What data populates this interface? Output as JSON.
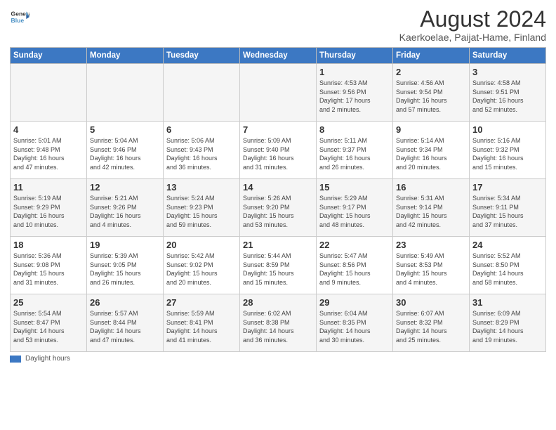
{
  "header": {
    "logo_line1": "General",
    "logo_line2": "Blue",
    "title": "August 2024",
    "subtitle": "Kaerkoelae, Paijat-Hame, Finland"
  },
  "days_of_week": [
    "Sunday",
    "Monday",
    "Tuesday",
    "Wednesday",
    "Thursday",
    "Friday",
    "Saturday"
  ],
  "weeks": [
    [
      {
        "num": "",
        "info": ""
      },
      {
        "num": "",
        "info": ""
      },
      {
        "num": "",
        "info": ""
      },
      {
        "num": "",
        "info": ""
      },
      {
        "num": "1",
        "info": "Sunrise: 4:53 AM\nSunset: 9:56 PM\nDaylight: 17 hours\nand 2 minutes."
      },
      {
        "num": "2",
        "info": "Sunrise: 4:56 AM\nSunset: 9:54 PM\nDaylight: 16 hours\nand 57 minutes."
      },
      {
        "num": "3",
        "info": "Sunrise: 4:58 AM\nSunset: 9:51 PM\nDaylight: 16 hours\nand 52 minutes."
      }
    ],
    [
      {
        "num": "4",
        "info": "Sunrise: 5:01 AM\nSunset: 9:48 PM\nDaylight: 16 hours\nand 47 minutes."
      },
      {
        "num": "5",
        "info": "Sunrise: 5:04 AM\nSunset: 9:46 PM\nDaylight: 16 hours\nand 42 minutes."
      },
      {
        "num": "6",
        "info": "Sunrise: 5:06 AM\nSunset: 9:43 PM\nDaylight: 16 hours\nand 36 minutes."
      },
      {
        "num": "7",
        "info": "Sunrise: 5:09 AM\nSunset: 9:40 PM\nDaylight: 16 hours\nand 31 minutes."
      },
      {
        "num": "8",
        "info": "Sunrise: 5:11 AM\nSunset: 9:37 PM\nDaylight: 16 hours\nand 26 minutes."
      },
      {
        "num": "9",
        "info": "Sunrise: 5:14 AM\nSunset: 9:34 PM\nDaylight: 16 hours\nand 20 minutes."
      },
      {
        "num": "10",
        "info": "Sunrise: 5:16 AM\nSunset: 9:32 PM\nDaylight: 16 hours\nand 15 minutes."
      }
    ],
    [
      {
        "num": "11",
        "info": "Sunrise: 5:19 AM\nSunset: 9:29 PM\nDaylight: 16 hours\nand 10 minutes."
      },
      {
        "num": "12",
        "info": "Sunrise: 5:21 AM\nSunset: 9:26 PM\nDaylight: 16 hours\nand 4 minutes."
      },
      {
        "num": "13",
        "info": "Sunrise: 5:24 AM\nSunset: 9:23 PM\nDaylight: 15 hours\nand 59 minutes."
      },
      {
        "num": "14",
        "info": "Sunrise: 5:26 AM\nSunset: 9:20 PM\nDaylight: 15 hours\nand 53 minutes."
      },
      {
        "num": "15",
        "info": "Sunrise: 5:29 AM\nSunset: 9:17 PM\nDaylight: 15 hours\nand 48 minutes."
      },
      {
        "num": "16",
        "info": "Sunrise: 5:31 AM\nSunset: 9:14 PM\nDaylight: 15 hours\nand 42 minutes."
      },
      {
        "num": "17",
        "info": "Sunrise: 5:34 AM\nSunset: 9:11 PM\nDaylight: 15 hours\nand 37 minutes."
      }
    ],
    [
      {
        "num": "18",
        "info": "Sunrise: 5:36 AM\nSunset: 9:08 PM\nDaylight: 15 hours\nand 31 minutes."
      },
      {
        "num": "19",
        "info": "Sunrise: 5:39 AM\nSunset: 9:05 PM\nDaylight: 15 hours\nand 26 minutes."
      },
      {
        "num": "20",
        "info": "Sunrise: 5:42 AM\nSunset: 9:02 PM\nDaylight: 15 hours\nand 20 minutes."
      },
      {
        "num": "21",
        "info": "Sunrise: 5:44 AM\nSunset: 8:59 PM\nDaylight: 15 hours\nand 15 minutes."
      },
      {
        "num": "22",
        "info": "Sunrise: 5:47 AM\nSunset: 8:56 PM\nDaylight: 15 hours\nand 9 minutes."
      },
      {
        "num": "23",
        "info": "Sunrise: 5:49 AM\nSunset: 8:53 PM\nDaylight: 15 hours\nand 4 minutes."
      },
      {
        "num": "24",
        "info": "Sunrise: 5:52 AM\nSunset: 8:50 PM\nDaylight: 14 hours\nand 58 minutes."
      }
    ],
    [
      {
        "num": "25",
        "info": "Sunrise: 5:54 AM\nSunset: 8:47 PM\nDaylight: 14 hours\nand 53 minutes."
      },
      {
        "num": "26",
        "info": "Sunrise: 5:57 AM\nSunset: 8:44 PM\nDaylight: 14 hours\nand 47 minutes."
      },
      {
        "num": "27",
        "info": "Sunrise: 5:59 AM\nSunset: 8:41 PM\nDaylight: 14 hours\nand 41 minutes."
      },
      {
        "num": "28",
        "info": "Sunrise: 6:02 AM\nSunset: 8:38 PM\nDaylight: 14 hours\nand 36 minutes."
      },
      {
        "num": "29",
        "info": "Sunrise: 6:04 AM\nSunset: 8:35 PM\nDaylight: 14 hours\nand 30 minutes."
      },
      {
        "num": "30",
        "info": "Sunrise: 6:07 AM\nSunset: 8:32 PM\nDaylight: 14 hours\nand 25 minutes."
      },
      {
        "num": "31",
        "info": "Sunrise: 6:09 AM\nSunset: 8:29 PM\nDaylight: 14 hours\nand 19 minutes."
      }
    ]
  ],
  "footer": {
    "legend_label": "Daylight hours"
  }
}
